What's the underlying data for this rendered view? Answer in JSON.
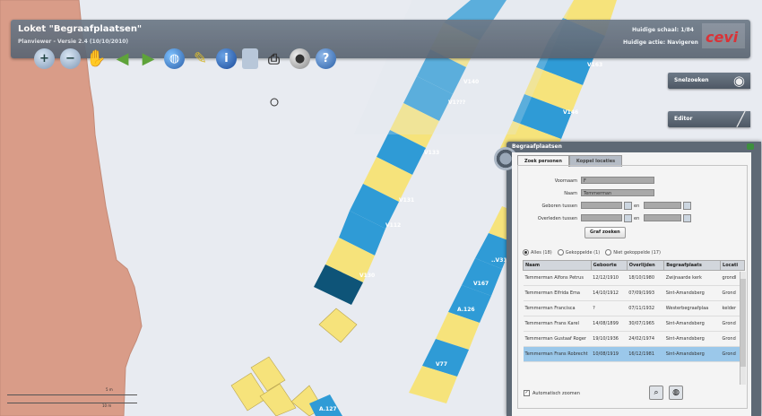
{
  "header": {
    "title": "Loket \"Begraafplaatsen\"",
    "subtitle": "Planviewer - Versie 2.4 (10/10/2010)",
    "scale_text": "Huidige schaal: 1/84",
    "action_text": "Huidige actie: Navigeren",
    "logo": "cevi"
  },
  "toolbar": {
    "icons": [
      "zoom-in-icon",
      "zoom-out-icon",
      "pan-hand-icon",
      "previous-extent-icon",
      "next-extent-icon",
      "full-extent-globe-icon",
      "clear-broom-icon",
      "info-icon",
      "document-icon",
      "print-icon",
      "layers-ball-icon",
      "help-icon"
    ]
  },
  "side_buttons": {
    "search_label": "Snelzoeken",
    "editor_label": "Editor"
  },
  "panel": {
    "title": "Begraafplaatsen",
    "tabs": [
      "Zoek personen",
      "Koppel locaties"
    ],
    "form": {
      "voornaam_label": "Voornaam",
      "voornaam_value": "F",
      "naam_label": "Naam",
      "naam_value": "Temmerman",
      "geboren_label": "Geboren tussen",
      "overleden_label": "Overleden tussen",
      "en_label": "en",
      "search_button": "Graf zoeken"
    },
    "filters": [
      {
        "label": "Alles (18)",
        "on": true
      },
      {
        "label": "Gekoppelde (1)",
        "on": false
      },
      {
        "label": "Niet gekoppelde (17)",
        "on": false
      }
    ],
    "table": {
      "headers": [
        "Naam",
        "Geboorte",
        "Overlijden",
        "Begraafplaats",
        "Locati"
      ],
      "rows": [
        [
          "Temmerman Alfons Petrus",
          "12/12/1910",
          "18/10/1980",
          "Zwijnaarde kerk",
          "grondl"
        ],
        [
          "Temmerman Elfrida Ema",
          "14/10/1912",
          "07/09/1993",
          "Sint-Amandsberg",
          "Grond"
        ],
        [
          "Temmerman Francisca",
          "?",
          "07/11/1932",
          "Westerbegraafplaa",
          "kelder"
        ],
        [
          "Temmerman Frans Karel",
          "14/08/1899",
          "30/07/1965",
          "Sint-Amandsberg",
          "Grond"
        ],
        [
          "Temmerman Gustaaf Roger",
          "19/10/1936",
          "24/02/1974",
          "Sint-Amandsberg",
          "Grond"
        ],
        [
          "Temmerman Frans Robrecht",
          "10/08/1919",
          "16/12/1981",
          "Sint-Amandsberg",
          "Grond"
        ]
      ],
      "selected_row": 5
    },
    "auto_zoom_label": "Automatisch zoomen"
  },
  "map": {
    "plot_labels": [
      "V140",
      "V1???",
      "V133",
      "V131",
      "V112",
      "V11",
      "V130",
      "V163",
      "V146",
      "..V31",
      "V167",
      "A.126",
      "V77",
      "A.127"
    ],
    "scale_1": "5 m",
    "scale_2": "10 m"
  }
}
